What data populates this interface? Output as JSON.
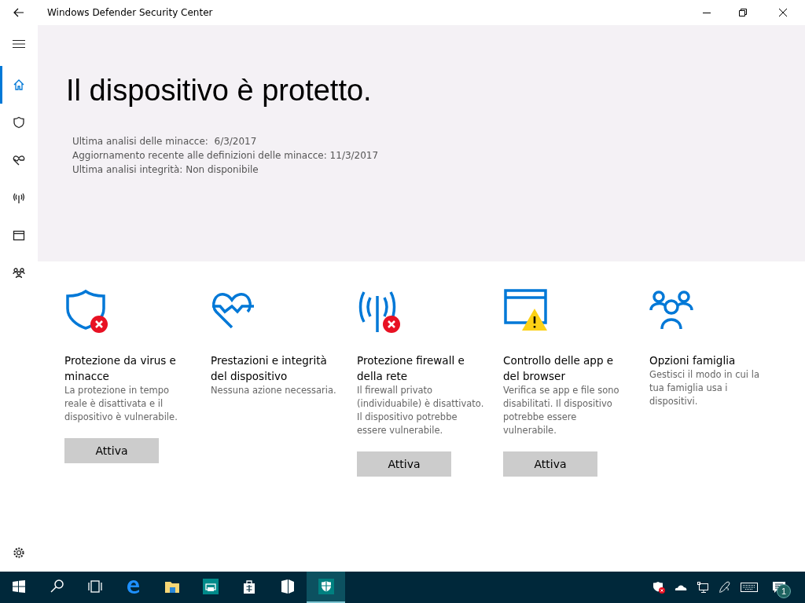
{
  "window": {
    "title": "Windows Defender Security Center"
  },
  "sidebar": {
    "items": [
      {
        "kind": "home",
        "selected": true
      },
      {
        "kind": "shield",
        "selected": false
      },
      {
        "kind": "heart",
        "selected": false
      },
      {
        "kind": "antenna",
        "selected": false
      },
      {
        "kind": "browser",
        "selected": false
      },
      {
        "kind": "family",
        "selected": false
      }
    ]
  },
  "hero": {
    "title": "Il dispositivo è protetto.",
    "details": [
      "Ultima analisi delle minacce:  6/3/2017",
      "Aggiornamento recente alle definizioni delle minacce: 11/3/2017",
      "Ultima analisi integrità: Non disponibile"
    ]
  },
  "tiles": [
    {
      "kind": "shield",
      "error": true,
      "warning": false,
      "title": "Protezione da virus e minacce",
      "description": "La protezione in tempo reale è disattivata e il dispositivo è vulnerabile.",
      "button": "Attiva"
    },
    {
      "kind": "heart",
      "error": false,
      "warning": false,
      "title": "Prestazioni e integrità del dispositivo",
      "description": "Nessuna azione necessaria."
    },
    {
      "kind": "antenna",
      "error": true,
      "warning": false,
      "title": "Protezione firewall e della rete",
      "description": "Il firewall privato (individuabile) è disattivato. Il dispositivo potrebbe essere vulnerabile.",
      "button": "Attiva"
    },
    {
      "kind": "browser",
      "error": false,
      "warning": true,
      "title": "Controllo delle app e del browser",
      "description": "Verifica se app e file sono disabilitati. Il dispositivo potrebbe essere vulnerabile.",
      "button": "Attiva"
    },
    {
      "kind": "family",
      "error": false,
      "warning": false,
      "title": "Opzioni famiglia",
      "description": "Gestisci il modo in cui la tua famiglia usa i dispositivi."
    }
  ],
  "taskbar": {
    "apps": [
      {
        "kind": "search",
        "selected": false
      },
      {
        "kind": "taskview",
        "selected": false
      },
      {
        "kind": "edge",
        "selected": false
      },
      {
        "kind": "explorer",
        "selected": false
      },
      {
        "kind": "printer",
        "selected": false
      },
      {
        "kind": "store",
        "selected": false
      },
      {
        "kind": "windowapp",
        "selected": false
      },
      {
        "kind": "defender",
        "selected": true
      }
    ],
    "notification_count": "1"
  }
}
